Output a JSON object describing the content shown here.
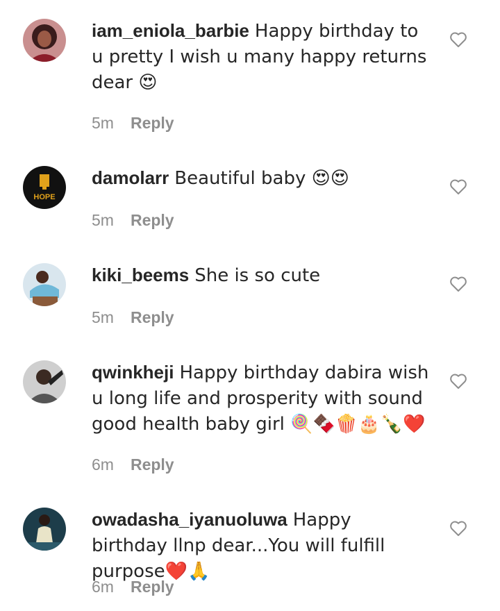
{
  "comments": [
    {
      "username": "iam_eniola_barbie",
      "text": "Happy birthday to u pretty I wish u many happy returns dear 😍",
      "time": "5m",
      "reply": "Reply",
      "avatar_color": "#7a2a2a"
    },
    {
      "username": "damolarr",
      "text": "Beautiful baby 😍😍",
      "time": "5m",
      "reply": "Reply",
      "avatar_color": "#111111",
      "avatar_text": "HOPE"
    },
    {
      "username": "kiki_beems",
      "text": "She is so cute",
      "time": "5m",
      "reply": "Reply",
      "avatar_color": "#6fb8d8"
    },
    {
      "username": "qwinkheji",
      "text": "Happy birthday dabira wish u long life and prosperity with sound good health baby girl 🍭🍫🍿🎂🍾❤️",
      "time": "6m",
      "reply": "Reply",
      "avatar_color": "#8a8a8a"
    },
    {
      "username": "owadasha_iyanuoluwa",
      "text": "Happy birthday llnp dear...You will fulfill purpose❤️🙏",
      "time": "6m",
      "reply": "Reply",
      "avatar_color": "#2c5a6a"
    }
  ],
  "icons": {
    "like": "heart-outline-icon"
  }
}
